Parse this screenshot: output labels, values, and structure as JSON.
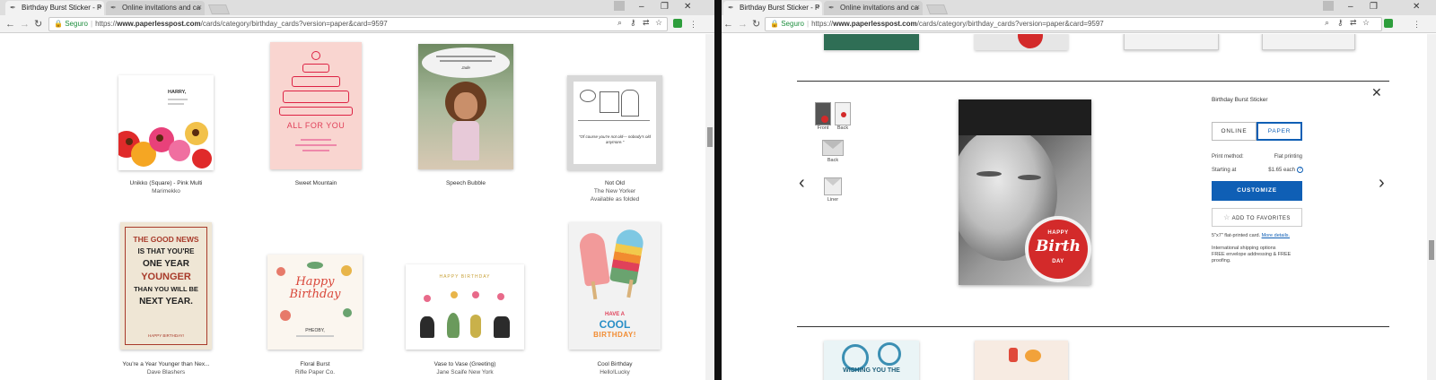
{
  "left_window": {
    "tabs": [
      {
        "title": "Birthday Burst Sticker - P",
        "active": true
      },
      {
        "title": "Online invitations and ca",
        "active": false
      }
    ],
    "address": {
      "secure_label": "Seguro",
      "url_prefix": "https://",
      "url_host": "www.paperlesspost.com",
      "url_path": "/cards/category/birthday_cards?version=paper&card=9597"
    },
    "cards": [
      {
        "name": "Unikko (Square) - Pink Multi",
        "brand": "Marimekko",
        "note": "",
        "card_text": "HARRY,"
      },
      {
        "name": "Sweet Mountain",
        "brand": "",
        "note": "",
        "card_text": "ALL FOR YOU"
      },
      {
        "name": "Speech Bubble",
        "brand": "",
        "note": "",
        "card_text": "Jade"
      },
      {
        "name": "Not Old",
        "brand": "The New Yorker",
        "note": "Available as folded",
        "card_text": "\"Of course you're not old— nobody's old anymore.\""
      },
      {
        "name": "You're a Year Younger than Nex...",
        "brand": "Dave Blashers",
        "note": "",
        "card_text": [
          "THE GOOD NEWS",
          "IS THAT YOU'RE",
          "ONE YEAR",
          "YOUNGER",
          "THAN YOU WILL BE",
          "NEXT YEAR."
        ],
        "card_footer": "HAPPY BIRTHDAY!"
      },
      {
        "name": "Floral Burst",
        "brand": "Rifle Paper Co.",
        "note": "",
        "card_text": [
          "Happy",
          "Birthday"
        ],
        "card_footer": "PHEOBY,"
      },
      {
        "name": "Vase to Vase (Greeting)",
        "brand": "Jane Scaife New York",
        "note": "",
        "card_text": "HAPPY BIRTHDAY"
      },
      {
        "name": "Cool Birthday",
        "brand": "Hello!Lucky",
        "note": "",
        "card_text": [
          "HAVE A",
          "COOL",
          "BIRTHDAY!"
        ]
      }
    ]
  },
  "right_window": {
    "tabs": [
      {
        "title": "Birthday Burst Sticker - P",
        "active": true
      },
      {
        "title": "Online invitations and ca",
        "active": false
      }
    ],
    "address": {
      "secure_label": "Seguro",
      "url_prefix": "https://",
      "url_host": "www.paperlesspost.com",
      "url_path": "/cards/category/birthday_cards?version=paper&card=9597"
    },
    "detail": {
      "title": "Birthday Burst Sticker",
      "version_options": [
        "ONLINE",
        "PAPER"
      ],
      "selected_version": "PAPER",
      "print_method_label": "Print method:",
      "print_method_value": "Flat printing",
      "starting_label": "Starting at",
      "starting_value": "$1.65 each",
      "customize_label": "CUSTOMIZE",
      "favorite_label": "ADD TO FAVORITES",
      "size_note": "5\"x7\" flat-printed card.",
      "more_details": "More details.",
      "shipping_note": [
        "International shipping options",
        "FREE envelope addressing & FREE",
        "proofing."
      ],
      "thumbnails": [
        {
          "label": "Front"
        },
        {
          "label": "Back"
        },
        {
          "label": "Back"
        },
        {
          "label": "Liner"
        }
      ],
      "sticker_text": [
        "HAPPY",
        "Birth",
        "DAY"
      ]
    },
    "bottom_card_text": "WISHING YOU THE"
  },
  "colors": {
    "accent_blue": "#0f5fb5",
    "secure_green": "#1e8e3e"
  }
}
